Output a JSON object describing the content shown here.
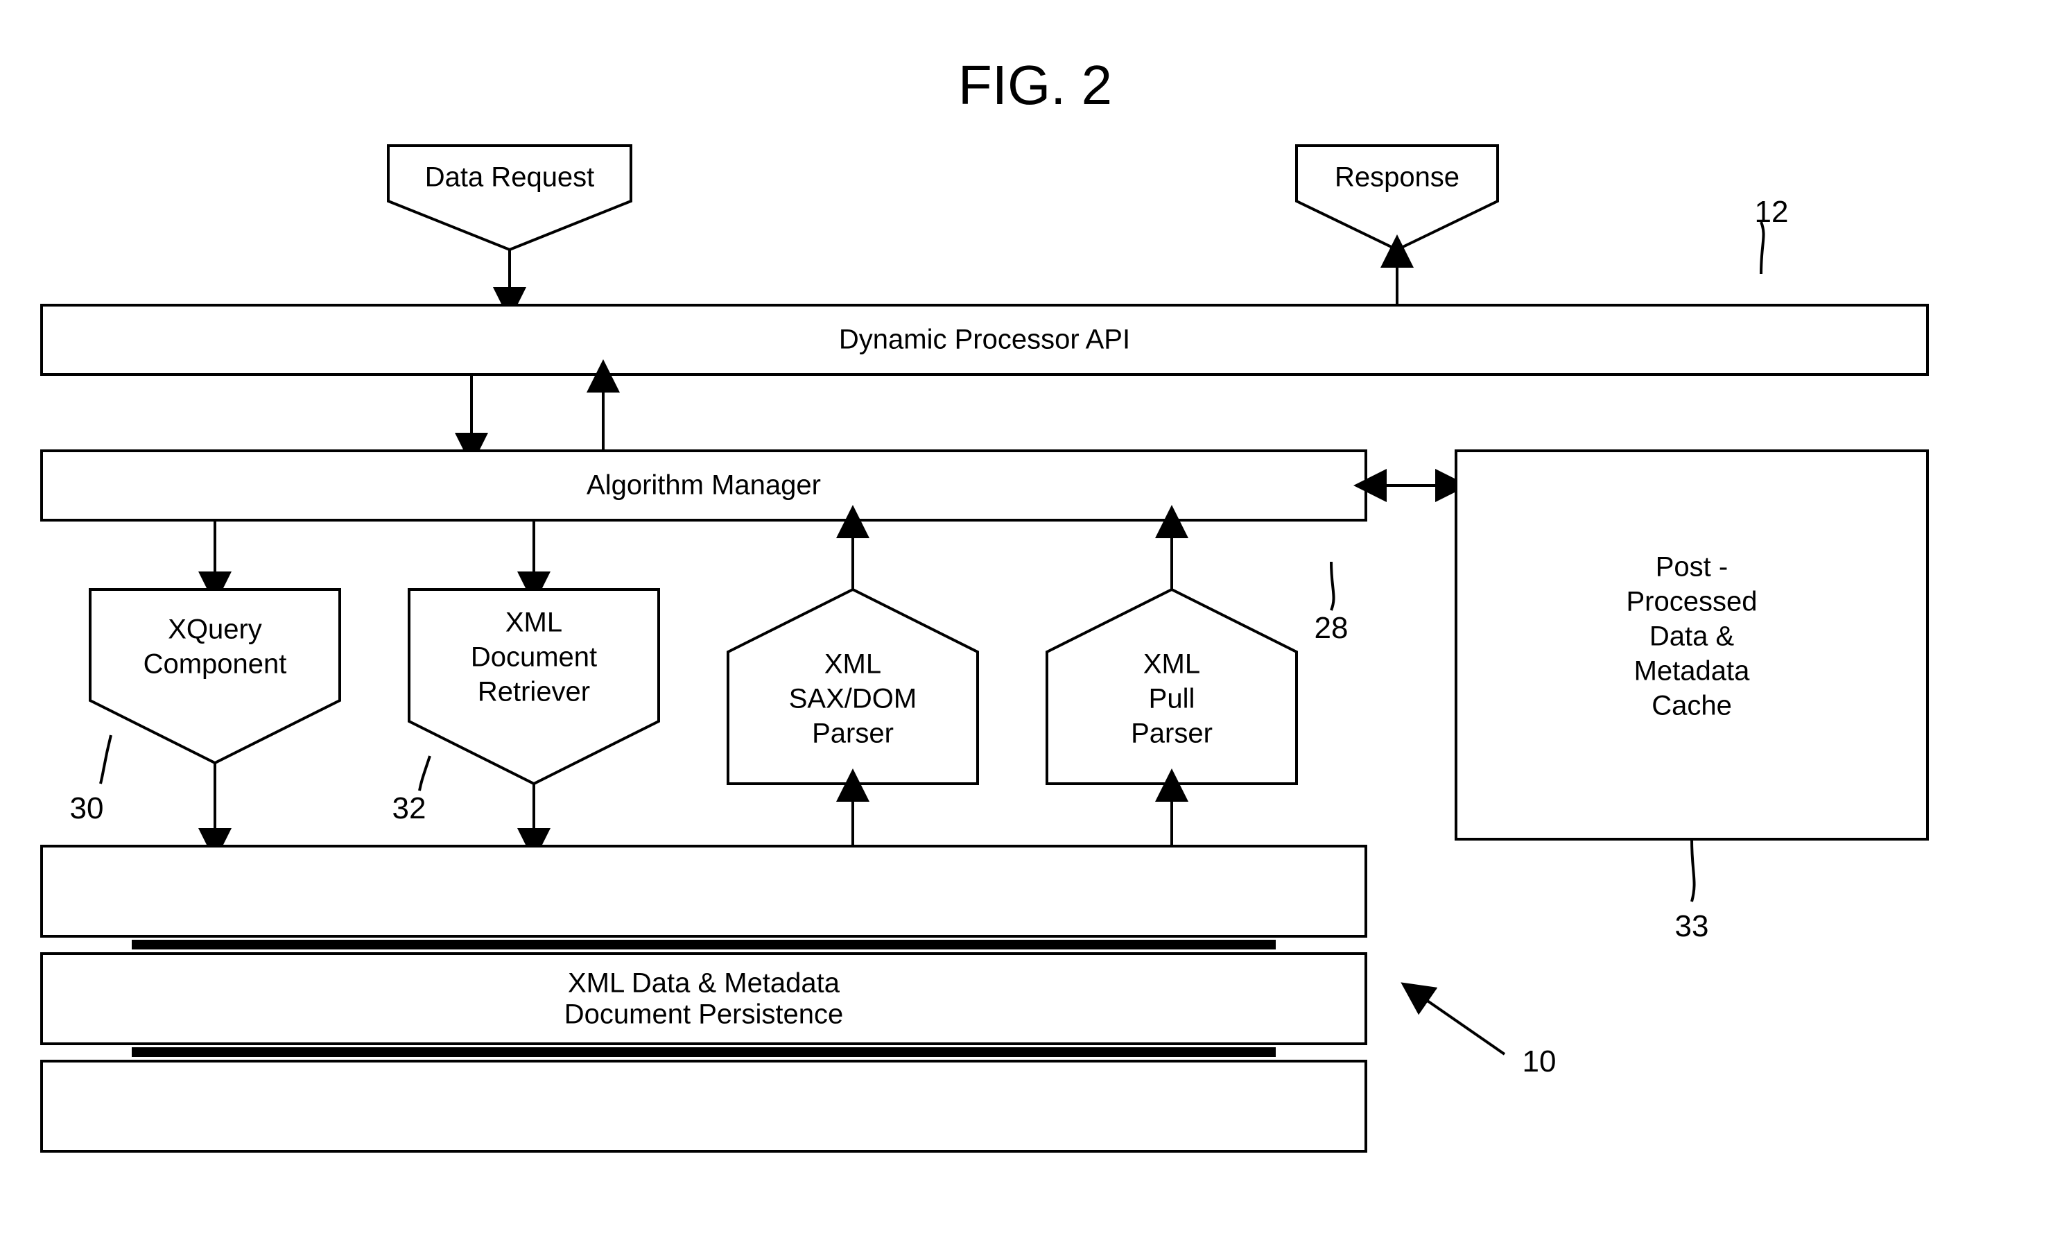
{
  "figure_label": "FIG. 2",
  "io": {
    "request": "Data Request",
    "response": "Response"
  },
  "blocks": {
    "api": "Dynamic Processor API",
    "manager": "Algorithm Manager",
    "xquery": {
      "l1": "XQuery",
      "l2": "Component"
    },
    "retriever": {
      "l1": "XML",
      "l2": "Document",
      "l3": "Retriever"
    },
    "saxdom": {
      "l1": "XML",
      "l2": "SAX/DOM",
      "l3": "Parser"
    },
    "pull": {
      "l1": "XML",
      "l2": "Pull",
      "l3": "Parser"
    },
    "persistence": {
      "l1": "XML Data & Metadata",
      "l2": "Document Persistence"
    },
    "cache": {
      "l1": "Post -",
      "l2": "Processed",
      "l3": "Data &",
      "l4": "Metadata",
      "l5": "Cache"
    }
  },
  "refs": {
    "r10": "10",
    "r12": "12",
    "r28": "28",
    "r30": "30",
    "r32": "32",
    "r33": "33"
  }
}
